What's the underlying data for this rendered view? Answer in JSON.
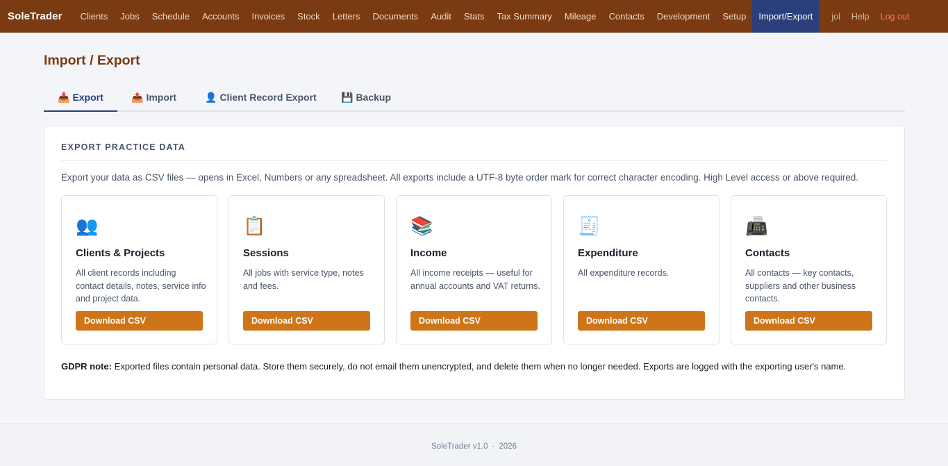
{
  "nav": {
    "brand": "SoleTrader",
    "items": [
      "Clients",
      "Jobs",
      "Schedule",
      "Accounts",
      "Invoices",
      "Stock",
      "Letters",
      "Documents",
      "Audit",
      "Stats",
      "Tax Summary",
      "Mileage",
      "Contacts",
      "Development",
      "Setup",
      "Import/Export"
    ],
    "active": "Import/Export",
    "user": "jol",
    "help": "Help",
    "logout": "Log out"
  },
  "page": {
    "title": "Import / Export"
  },
  "tabs": [
    {
      "label": "Export",
      "icon": "📥",
      "icon_name": "inbox-tray-icon",
      "active": true
    },
    {
      "label": "Import",
      "icon": "📤",
      "icon_name": "outbox-tray-icon",
      "active": false
    },
    {
      "label": "Client Record Export",
      "icon": "👤",
      "icon_name": "user-icon",
      "active": false
    },
    {
      "label": "Backup",
      "icon": "💾",
      "icon_name": "floppy-disk-icon",
      "active": false
    }
  ],
  "export": {
    "heading": "EXPORT PRACTICE DATA",
    "intro": "Export your data as CSV files — opens in Excel, Numbers or any spreadsheet. All exports include a UTF-8 byte order mark for correct character encoding. High Level access or above required.",
    "tiles": [
      {
        "icon": "👥",
        "icon_name": "people-icon",
        "title": "Clients & Projects",
        "desc": "All client records including contact details, notes, service info and project data.",
        "button": "Download CSV"
      },
      {
        "icon": "📋",
        "icon_name": "clipboard-icon",
        "title": "Sessions",
        "desc": "All jobs with service type, notes and fees.",
        "button": "Download CSV"
      },
      {
        "icon": "📚",
        "icon_name": "ledger-books-icon",
        "title": "Income",
        "desc": "All income receipts — useful for annual accounts and VAT returns.",
        "button": "Download CSV"
      },
      {
        "icon": "🧾",
        "icon_name": "receipt-icon",
        "title": "Expenditure",
        "desc": "All expenditure records.",
        "button": "Download CSV"
      },
      {
        "icon": "📠",
        "icon_name": "fax-machine-icon",
        "title": "Contacts",
        "desc": "All contacts — key contacts, suppliers and other business contacts.",
        "button": "Download CSV"
      }
    ],
    "gdpr_label": "GDPR note:",
    "gdpr_text": " Exported files contain personal data. Store them securely, do not email them unencrypted, and delete them when no longer needed. Exports are logged with the exporting user's name."
  },
  "footer": {
    "version": "SoleTrader v1.0",
    "separator": "·",
    "year": "2026"
  },
  "colors": {
    "nav_bg": "#7a3a12",
    "active_nav": "#2a3f7c",
    "button": "#cf7519",
    "logout": "#ff7a52"
  }
}
